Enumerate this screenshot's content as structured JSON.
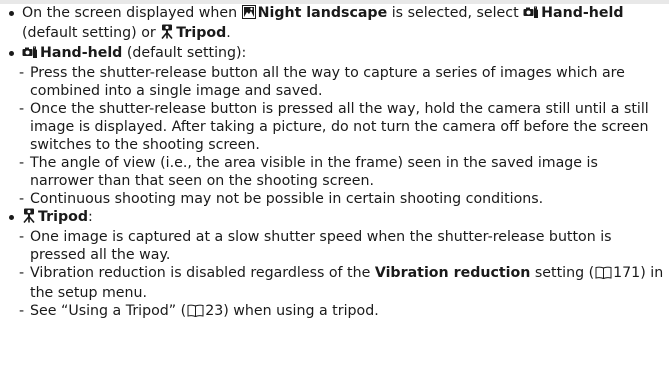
{
  "intro": {
    "t1": "On the screen displayed when ",
    "night_label": "Night landscape",
    "t2": " is selected, select ",
    "handheld_label": "Hand-held",
    "t3": " (default setting) or ",
    "tripod_label": "Tripod",
    "t4": "."
  },
  "handheld": {
    "heading": "Hand-held",
    "heading_suffix": " (default setting):",
    "items": [
      "Press the shutter-release button all the way to capture a series of images which are combined into a single image and saved.",
      "Once the shutter-release button is pressed all the way, hold the camera still until a still image is displayed. After taking a picture, do not turn the camera off before the screen switches to the shooting screen.",
      "The angle of view (i.e., the area visible in the frame) seen in the saved image is narrower than that seen on the shooting screen.",
      "Continuous shooting may not be possible in certain shooting conditions."
    ]
  },
  "tripod": {
    "heading": "Tripod",
    "heading_suffix": ":",
    "item1": "One image is captured at a slow shutter speed when the shutter-release button is pressed all the way.",
    "item2_a": "Vibration reduction is disabled regardless of the ",
    "item2_bold": "Vibration reduction",
    "item2_b": " setting (",
    "item2_page": "171",
    "item2_c": ") in the setup menu.",
    "item3_a": "See “Using a Tripod” (",
    "item3_page": "23",
    "item3_b": ") when using a tripod."
  },
  "icons": {
    "night": "night-landscape-icon",
    "handheld": "hand-held-icon",
    "tripod": "tripod-icon",
    "book": "book-reference-icon"
  }
}
